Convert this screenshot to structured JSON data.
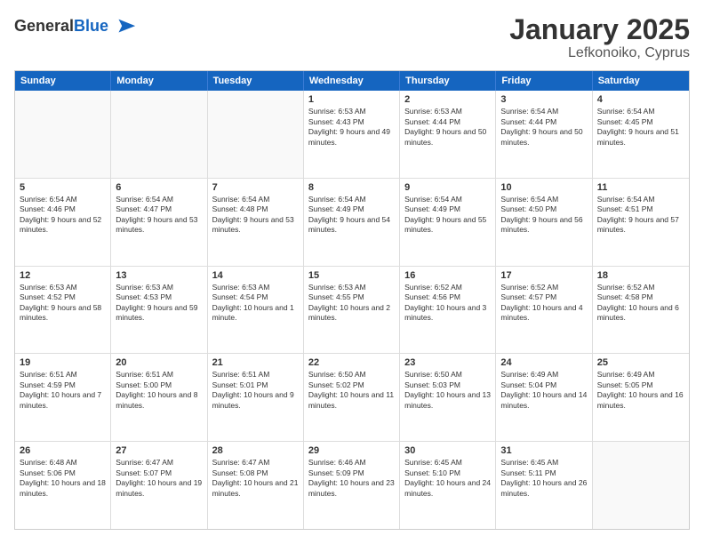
{
  "logo": {
    "general": "General",
    "blue": "Blue"
  },
  "header": {
    "title": "January 2025",
    "subtitle": "Lefkonoiko, Cyprus"
  },
  "dayNames": [
    "Sunday",
    "Monday",
    "Tuesday",
    "Wednesday",
    "Thursday",
    "Friday",
    "Saturday"
  ],
  "rows": [
    [
      {
        "day": "",
        "empty": true
      },
      {
        "day": "",
        "empty": true
      },
      {
        "day": "",
        "empty": true
      },
      {
        "day": "1",
        "sunrise": "6:53 AM",
        "sunset": "4:43 PM",
        "daylight": "9 hours and 49 minutes."
      },
      {
        "day": "2",
        "sunrise": "6:53 AM",
        "sunset": "4:44 PM",
        "daylight": "9 hours and 50 minutes."
      },
      {
        "day": "3",
        "sunrise": "6:54 AM",
        "sunset": "4:44 PM",
        "daylight": "9 hours and 50 minutes."
      },
      {
        "day": "4",
        "sunrise": "6:54 AM",
        "sunset": "4:45 PM",
        "daylight": "9 hours and 51 minutes."
      }
    ],
    [
      {
        "day": "5",
        "sunrise": "6:54 AM",
        "sunset": "4:46 PM",
        "daylight": "9 hours and 52 minutes."
      },
      {
        "day": "6",
        "sunrise": "6:54 AM",
        "sunset": "4:47 PM",
        "daylight": "9 hours and 53 minutes."
      },
      {
        "day": "7",
        "sunrise": "6:54 AM",
        "sunset": "4:48 PM",
        "daylight": "9 hours and 53 minutes."
      },
      {
        "day": "8",
        "sunrise": "6:54 AM",
        "sunset": "4:49 PM",
        "daylight": "9 hours and 54 minutes."
      },
      {
        "day": "9",
        "sunrise": "6:54 AM",
        "sunset": "4:49 PM",
        "daylight": "9 hours and 55 minutes."
      },
      {
        "day": "10",
        "sunrise": "6:54 AM",
        "sunset": "4:50 PM",
        "daylight": "9 hours and 56 minutes."
      },
      {
        "day": "11",
        "sunrise": "6:54 AM",
        "sunset": "4:51 PM",
        "daylight": "9 hours and 57 minutes."
      }
    ],
    [
      {
        "day": "12",
        "sunrise": "6:53 AM",
        "sunset": "4:52 PM",
        "daylight": "9 hours and 58 minutes."
      },
      {
        "day": "13",
        "sunrise": "6:53 AM",
        "sunset": "4:53 PM",
        "daylight": "9 hours and 59 minutes."
      },
      {
        "day": "14",
        "sunrise": "6:53 AM",
        "sunset": "4:54 PM",
        "daylight": "10 hours and 1 minute."
      },
      {
        "day": "15",
        "sunrise": "6:53 AM",
        "sunset": "4:55 PM",
        "daylight": "10 hours and 2 minutes."
      },
      {
        "day": "16",
        "sunrise": "6:52 AM",
        "sunset": "4:56 PM",
        "daylight": "10 hours and 3 minutes."
      },
      {
        "day": "17",
        "sunrise": "6:52 AM",
        "sunset": "4:57 PM",
        "daylight": "10 hours and 4 minutes."
      },
      {
        "day": "18",
        "sunrise": "6:52 AM",
        "sunset": "4:58 PM",
        "daylight": "10 hours and 6 minutes."
      }
    ],
    [
      {
        "day": "19",
        "sunrise": "6:51 AM",
        "sunset": "4:59 PM",
        "daylight": "10 hours and 7 minutes."
      },
      {
        "day": "20",
        "sunrise": "6:51 AM",
        "sunset": "5:00 PM",
        "daylight": "10 hours and 8 minutes."
      },
      {
        "day": "21",
        "sunrise": "6:51 AM",
        "sunset": "5:01 PM",
        "daylight": "10 hours and 9 minutes."
      },
      {
        "day": "22",
        "sunrise": "6:50 AM",
        "sunset": "5:02 PM",
        "daylight": "10 hours and 11 minutes."
      },
      {
        "day": "23",
        "sunrise": "6:50 AM",
        "sunset": "5:03 PM",
        "daylight": "10 hours and 13 minutes."
      },
      {
        "day": "24",
        "sunrise": "6:49 AM",
        "sunset": "5:04 PM",
        "daylight": "10 hours and 14 minutes."
      },
      {
        "day": "25",
        "sunrise": "6:49 AM",
        "sunset": "5:05 PM",
        "daylight": "10 hours and 16 minutes."
      }
    ],
    [
      {
        "day": "26",
        "sunrise": "6:48 AM",
        "sunset": "5:06 PM",
        "daylight": "10 hours and 18 minutes."
      },
      {
        "day": "27",
        "sunrise": "6:47 AM",
        "sunset": "5:07 PM",
        "daylight": "10 hours and 19 minutes."
      },
      {
        "day": "28",
        "sunrise": "6:47 AM",
        "sunset": "5:08 PM",
        "daylight": "10 hours and 21 minutes."
      },
      {
        "day": "29",
        "sunrise": "6:46 AM",
        "sunset": "5:09 PM",
        "daylight": "10 hours and 23 minutes."
      },
      {
        "day": "30",
        "sunrise": "6:45 AM",
        "sunset": "5:10 PM",
        "daylight": "10 hours and 24 minutes."
      },
      {
        "day": "31",
        "sunrise": "6:45 AM",
        "sunset": "5:11 PM",
        "daylight": "10 hours and 26 minutes."
      },
      {
        "day": "",
        "empty": true
      }
    ]
  ]
}
